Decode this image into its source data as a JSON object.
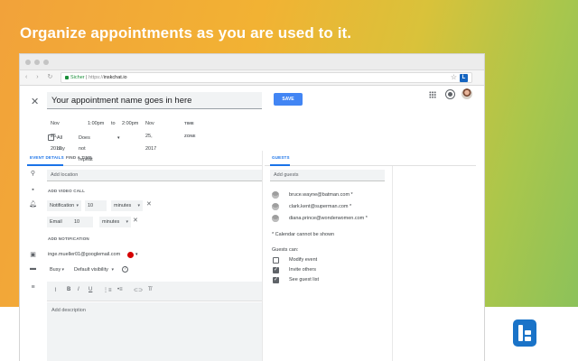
{
  "headline": "Organize appointments as you are used to it.",
  "browser": {
    "secure_label": "Sicher",
    "url_scheme": "https://",
    "url_host": "inskchat.io",
    "extension_label": "L"
  },
  "event": {
    "title": "Your appointment name goes in here",
    "save_label": "SAVE",
    "start_date": "Nov 25, 2017",
    "start_time": "1:00pm",
    "to_label": "to",
    "end_time": "2:00pm",
    "end_date": "Nov 25, 2017",
    "time_zone_label": "TIME ZONE",
    "all_day_label": "All day",
    "repeat_value": "Does not repeat"
  },
  "tabs": {
    "event_details": "EVENT DETAILS",
    "find_a_time": "FIND A TIME",
    "guests": "GUESTS"
  },
  "details": {
    "location_placeholder": "Add location",
    "add_video_call": "ADD VIDEO CALL",
    "notifications": [
      {
        "type": "Notification",
        "amount": "10",
        "unit": "minutes"
      },
      {
        "type": "Email",
        "amount": "10",
        "unit": "minutes"
      }
    ],
    "add_notification": "ADD NOTIFICATION",
    "calendar_owner": "inge.mueller01@googlemail.com",
    "calendar_color": "#d50000",
    "busy_value": "Busy",
    "visibility_value": "Default visibility",
    "help_glyph": "?",
    "description_placeholder": "Add description"
  },
  "editor_toolbar": {
    "attach_icon": "paperclip-icon",
    "bold": "B",
    "italic": "I",
    "underline": "U",
    "numbered_list_icon": "numbered-list-icon",
    "bulleted_list_icon": "bulleted-list-icon",
    "link_icon": "link-icon",
    "clear_format_icon": "clear-format-icon"
  },
  "guests": {
    "add_placeholder": "Add guests",
    "list": [
      "bruce.wayne@batman.com *",
      "clark.kent@superman.com *",
      "diana.prince@wonderwomen.com *"
    ],
    "note": "* Calendar cannot be shown",
    "permissions_label": "Guests can:",
    "permissions": [
      {
        "label": "Modify event",
        "checked": false
      },
      {
        "label": "Invite others",
        "checked": true
      },
      {
        "label": "See guest list",
        "checked": true
      }
    ]
  },
  "colors": {
    "accent_blue": "#4285f4",
    "tab_active": "#1a73e8",
    "logo_blue": "#1a73c8"
  }
}
